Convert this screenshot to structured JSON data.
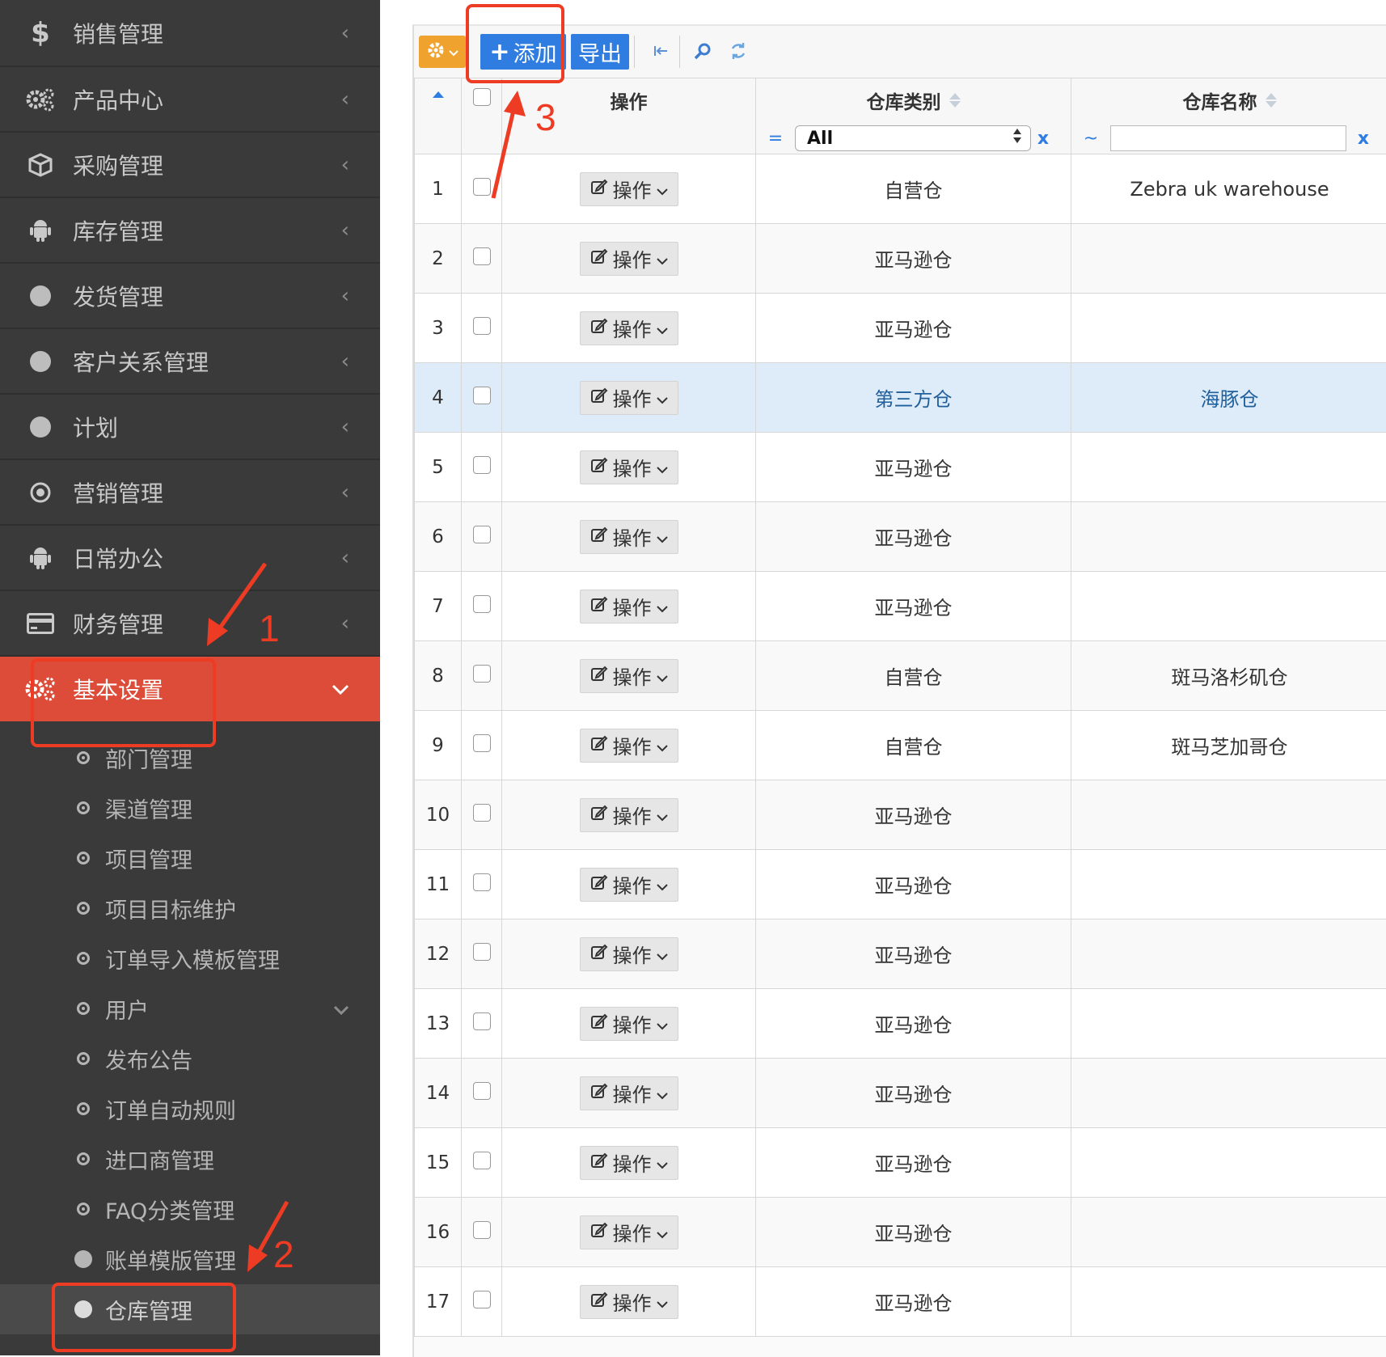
{
  "sidebar": {
    "menu": [
      {
        "label": "销售管理",
        "icon": "dollar-icon"
      },
      {
        "label": "产品中心",
        "icon": "gears-icon"
      },
      {
        "label": "采购管理",
        "icon": "cube-icon"
      },
      {
        "label": "库存管理",
        "icon": "android-icon"
      },
      {
        "label": "发货管理",
        "icon": "circle-icon"
      },
      {
        "label": "客户关系管理",
        "icon": "circle-icon"
      },
      {
        "label": "计划",
        "icon": "circle-icon"
      },
      {
        "label": "营销管理",
        "icon": "dot-circle-icon"
      },
      {
        "label": "日常办公",
        "icon": "android-icon"
      },
      {
        "label": "财务管理",
        "icon": "credit-card-icon"
      }
    ],
    "active_menu": {
      "label": "基本设置",
      "icon": "cogs-icon"
    },
    "submenu": [
      {
        "label": "部门管理"
      },
      {
        "label": "渠道管理"
      },
      {
        "label": "项目管理"
      },
      {
        "label": "项目目标维护"
      },
      {
        "label": "订单导入模板管理"
      },
      {
        "label": "用户"
      },
      {
        "label": "发布公告"
      },
      {
        "label": "订单自动规则"
      },
      {
        "label": "进口商管理"
      },
      {
        "label": "FAQ分类管理"
      },
      {
        "label": "账单模版管理"
      },
      {
        "label": "仓库管理"
      }
    ]
  },
  "toolbar": {
    "add_label": "添加",
    "export_label": "导出"
  },
  "table": {
    "headers": {
      "op": "操作",
      "category": "仓库类别",
      "name": "仓库名称"
    },
    "filters": {
      "category_op": "=",
      "category_value": "All",
      "name_op": "~",
      "name_value": "",
      "clear": "x"
    },
    "op_button_label": "操作",
    "rows": [
      {
        "num": "1",
        "category": "自营仓",
        "name": "Zebra uk warehouse"
      },
      {
        "num": "2",
        "category": "亚马逊仓",
        "name": ""
      },
      {
        "num": "3",
        "category": "亚马逊仓",
        "name": ""
      },
      {
        "num": "4",
        "category": "第三方仓",
        "name": "海豚仓"
      },
      {
        "num": "5",
        "category": "亚马逊仓",
        "name": ""
      },
      {
        "num": "6",
        "category": "亚马逊仓",
        "name": ""
      },
      {
        "num": "7",
        "category": "亚马逊仓",
        "name": ""
      },
      {
        "num": "8",
        "category": "自营仓",
        "name": "斑马洛杉矶仓"
      },
      {
        "num": "9",
        "category": "自营仓",
        "name": "斑马芝加哥仓"
      },
      {
        "num": "10",
        "category": "亚马逊仓",
        "name": ""
      },
      {
        "num": "11",
        "category": "亚马逊仓",
        "name": ""
      },
      {
        "num": "12",
        "category": "亚马逊仓",
        "name": ""
      },
      {
        "num": "13",
        "category": "亚马逊仓",
        "name": ""
      },
      {
        "num": "14",
        "category": "亚马逊仓",
        "name": ""
      },
      {
        "num": "15",
        "category": "亚马逊仓",
        "name": ""
      },
      {
        "num": "16",
        "category": "亚马逊仓",
        "name": ""
      },
      {
        "num": "17",
        "category": "亚马逊仓",
        "name": ""
      }
    ]
  },
  "annotations": {
    "step1": "1",
    "step2": "2",
    "step3": "3"
  },
  "colors": {
    "sidebar_bg": "#3a3a3a",
    "active": "#dd4b39",
    "primary": "#2f7de1",
    "annotation": "#ee3b24"
  }
}
